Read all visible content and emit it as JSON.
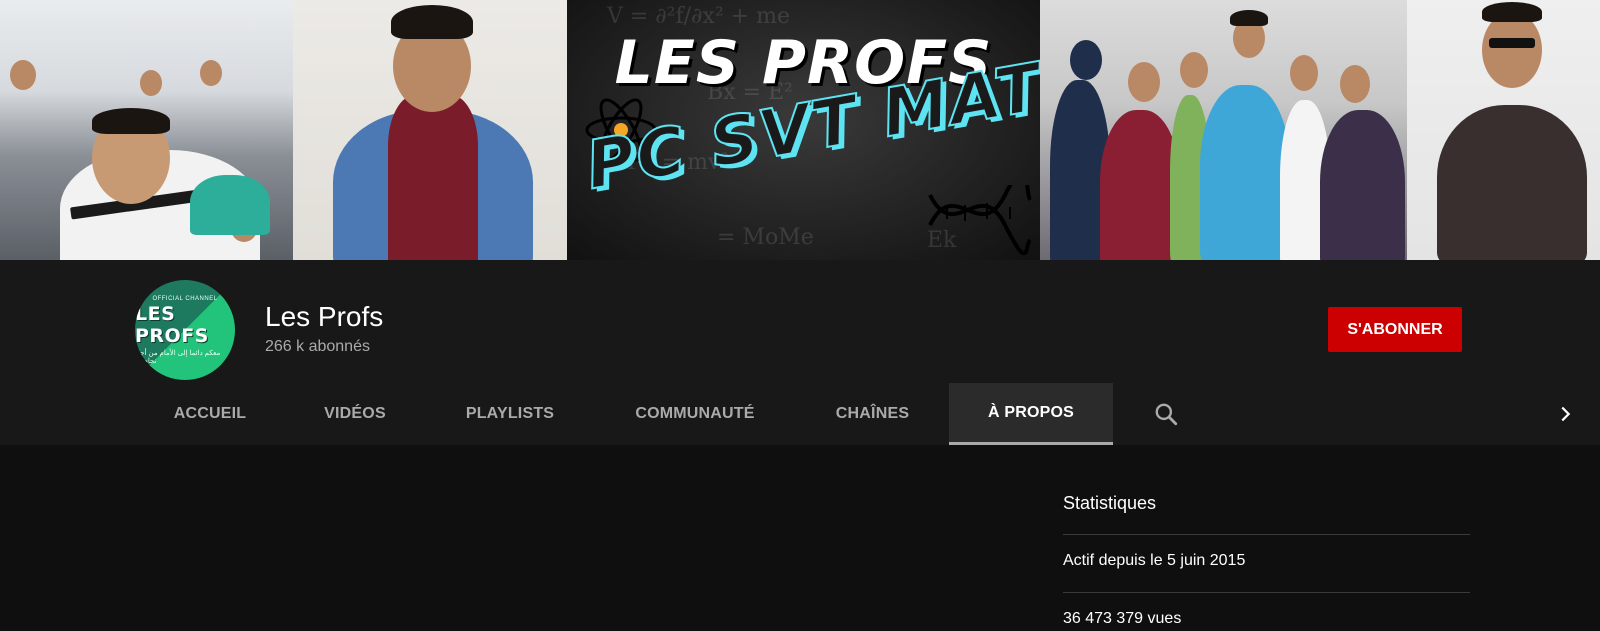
{
  "banner": {
    "title": "LES PROFS",
    "subtitle": "PC SVT MATH"
  },
  "channel": {
    "avatar_small_text": "OFFICIAL CHANNEL",
    "avatar_logo": "LES PROFS",
    "avatar_arabic": "معكم دائما إلى الأمام من أجل نجاحكم",
    "name": "Les Profs",
    "subscribers": "266 k abonnés",
    "subscribe_label": "S'ABONNER"
  },
  "tabs": [
    {
      "label": "ACCUEIL"
    },
    {
      "label": "VIDÉOS"
    },
    {
      "label": "PLAYLISTS"
    },
    {
      "label": "COMMUNAUTÉ"
    },
    {
      "label": "CHAÎNES"
    },
    {
      "label": "À PROPOS",
      "active": true
    }
  ],
  "icons": {
    "search": "search-icon",
    "next": "chevron-right-icon"
  },
  "stats": {
    "title": "Statistiques",
    "joined": "Actif depuis le 5 juin 2015",
    "views": "36 473 379 vues"
  },
  "colors": {
    "subscribe": "#cc0000",
    "header_bg": "#181818",
    "page_bg": "#0f0f0f",
    "banner_accent": "#5de3f2"
  }
}
